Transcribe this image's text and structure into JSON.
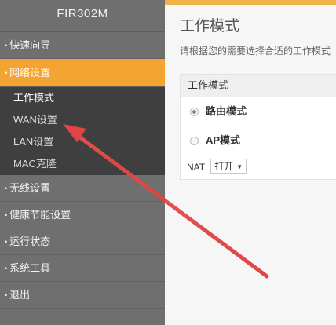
{
  "sidebar": {
    "brand": "FIR302M",
    "items": [
      {
        "label": "快速向导"
      },
      {
        "label": "网络设置",
        "sub": [
          "工作模式",
          "WAN设置",
          "LAN设置",
          "MAC克隆"
        ]
      },
      {
        "label": "无线设置"
      },
      {
        "label": "健康节能设置"
      },
      {
        "label": "运行状态"
      },
      {
        "label": "系统工具"
      },
      {
        "label": "退出"
      }
    ]
  },
  "main": {
    "title": "工作模式",
    "description": "请根据您的需要选择合适的工作模式",
    "panel_header": "工作模式",
    "modes": [
      {
        "label": "路由模式",
        "checked": true
      },
      {
        "label": "AP模式",
        "checked": false
      }
    ],
    "nat": {
      "label": "NAT",
      "value": "打开"
    }
  },
  "colors": {
    "sidebar_bg": "#6f6f6f",
    "active_item": "#f4a430",
    "submenu_bg": "#3f3f3f",
    "annotation_arrow": "#e23b3b"
  }
}
